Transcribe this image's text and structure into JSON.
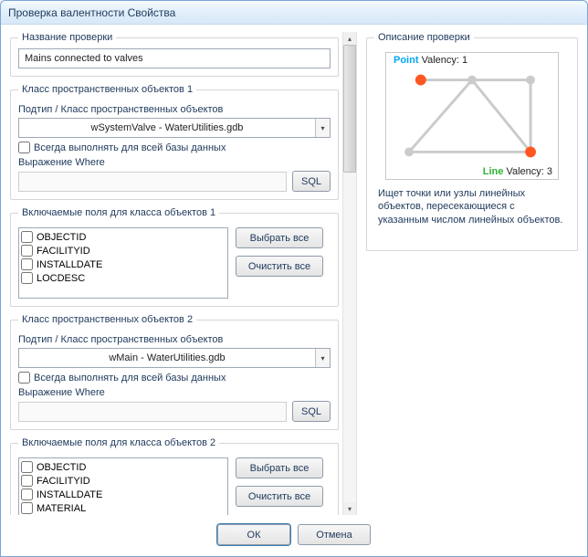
{
  "title": "Проверка валентности Свойства",
  "section_name": {
    "label": "Название проверки",
    "value": "Mains connected to valves"
  },
  "fc1": {
    "legend": "Класс пространственных объектов 1",
    "subtype_label": "Подтип / Класс пространственных объектов",
    "combo": "wSystemValve - WaterUtilities.gdb",
    "always_label": "Всегда выполнять для всей базы данных",
    "where_label": "Выражение Where",
    "sql": "SQL"
  },
  "fields1": {
    "legend": "Включаемые поля для класса объектов 1",
    "items": [
      "OBJECTID",
      "FACILITYID",
      "INSTALLDATE",
      "LOCDESC"
    ],
    "select_all": "Выбрать все",
    "clear_all": "Очистить все"
  },
  "fc2": {
    "legend": "Класс пространственных объектов 2",
    "subtype_label": "Подтип / Класс пространственных объектов",
    "combo": "wMain - WaterUtilities.gdb",
    "always_label": "Всегда выполнять для всей базы данных",
    "where_label": "Выражение Where",
    "sql": "SQL"
  },
  "fields2": {
    "legend": "Включаемые поля для класса объектов 2",
    "items": [
      "OBJECTID",
      "FACILITYID",
      "INSTALLDATE",
      "MATERIAL"
    ],
    "select_all": "Выбрать все",
    "clear_all": "Очистить все"
  },
  "desc": {
    "legend": "Описание проверки",
    "point_label": "Point",
    "point_valency": "Valency: 1",
    "line_label": "Line",
    "line_valency": "Valency: 3",
    "text": "Ищет точки или узлы линейных объектов, пересекающиеся с указанным числом линейных объектов."
  },
  "buttons": {
    "ok": "ОК",
    "cancel": "Отмена"
  }
}
